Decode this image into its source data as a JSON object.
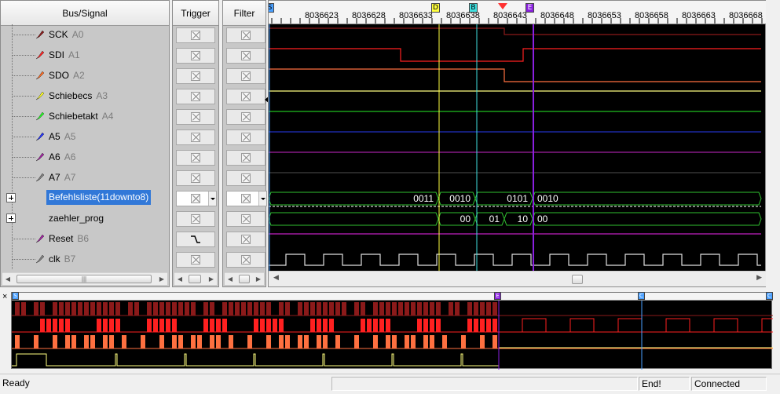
{
  "headers": {
    "bus_signal": "Bus/Signal",
    "trigger": "Trigger",
    "filter": "Filter"
  },
  "signals": [
    {
      "name": "SCK",
      "channel": "A0",
      "probe_color": "#8b1a1a",
      "trigger": "x",
      "filter": "x"
    },
    {
      "name": "SDI",
      "channel": "A1",
      "probe_color": "#ff2020",
      "trigger": "x",
      "filter": "x"
    },
    {
      "name": "SDO",
      "channel": "A2",
      "probe_color": "#ff6a20",
      "trigger": "x",
      "filter": "x"
    },
    {
      "name": "Schiebecs",
      "channel": "A3",
      "probe_color": "#ffff20",
      "trigger": "x",
      "filter": "x"
    },
    {
      "name": "Schiebetakt",
      "channel": "A4",
      "probe_color": "#20ff20",
      "trigger": "x",
      "filter": "x"
    },
    {
      "name": "A5",
      "channel": "A5",
      "probe_color": "#2030ff",
      "trigger": "x",
      "filter": "x"
    },
    {
      "name": "A6",
      "channel": "A6",
      "probe_color": "#a020a0",
      "trigger": "x",
      "filter": "x"
    },
    {
      "name": "A7",
      "channel": "A7",
      "probe_color": "#808080",
      "trigger": "x",
      "filter": "x"
    },
    {
      "name": "Befehlsliste(11downto8)",
      "channel": "",
      "probe_color": "",
      "trigger": "combo",
      "filter": "combo",
      "bus": true,
      "selected": true
    },
    {
      "name": "zaehler_prog",
      "channel": "",
      "probe_color": "",
      "trigger": "x",
      "filter": "x",
      "bus": true
    },
    {
      "name": "Reset",
      "channel": "B6",
      "probe_color": "#a020a0",
      "trigger": "edge",
      "filter": "x"
    },
    {
      "name": "clk",
      "channel": "B7",
      "probe_color": "#808080",
      "trigger": "x",
      "filter": "x"
    }
  ],
  "ruler": {
    "tick_labels": [
      "8036623",
      "8036628",
      "8036633",
      "8036638",
      "8036643",
      "8036648",
      "8036653",
      "8036658",
      "8036663",
      "8036668"
    ],
    "markers": [
      {
        "id": "S",
        "color": "#4aa0ff"
      },
      {
        "id": "D",
        "color": "#ffff40"
      },
      {
        "id": "B",
        "color": "#40e0e0"
      },
      {
        "id": "E",
        "color": "#8a20e0"
      },
      {
        "id": "T",
        "color": "#ff3030"
      }
    ]
  },
  "bus_values": {
    "befehlsliste": [
      "0011",
      "0010",
      "0101",
      "0010"
    ],
    "zaehler_prog": [
      "00",
      "01",
      "10",
      "00"
    ]
  },
  "overview": {
    "markers": [
      {
        "id": "S",
        "color": "#4aa0ff"
      },
      {
        "id": "E",
        "color": "#8a20e0"
      },
      {
        "id": "C",
        "color": "#4aa0ff"
      },
      {
        "id": "C",
        "color": "#4aa0ff"
      }
    ],
    "close_label": "×"
  },
  "status": {
    "ready": "Ready",
    "end": "End!",
    "connection": "Connected"
  },
  "colors": {
    "sck": "#8b1a1a",
    "sdi": "#ff2020",
    "sdo": "#ff7040",
    "schiebecs": "#ffff80",
    "schiebetakt": "#20c020",
    "a5": "#2030c0",
    "a6": "#a020a0",
    "reset": "#c020c0",
    "clk": "#e0e0e0",
    "bus": "#30c030"
  }
}
